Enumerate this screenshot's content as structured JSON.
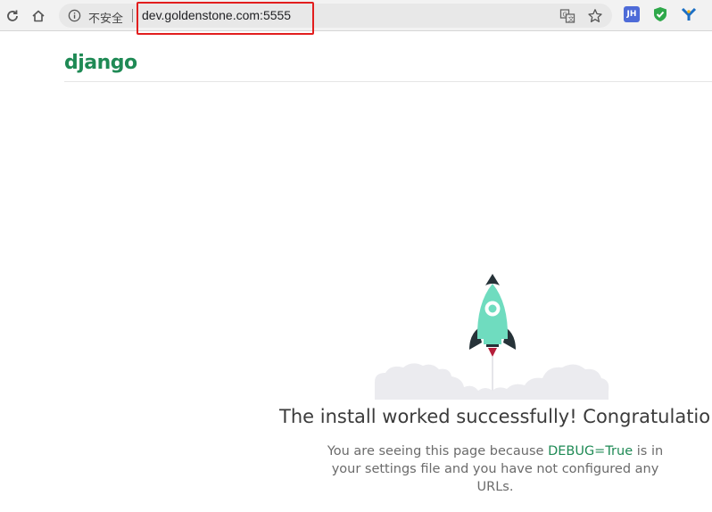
{
  "browser": {
    "security_label": "不安全",
    "url": "dev.goldenstone.com:5555",
    "icons": {
      "back": "back-icon",
      "home": "home-icon",
      "info": "info-icon",
      "translate": "translate-icon",
      "bookmark": "star-icon"
    },
    "extensions": [
      {
        "name": "jh-extension-icon",
        "text": "JH",
        "color": "#4e6bd8"
      },
      {
        "name": "shield-extension-icon",
        "color": "#2ea84a"
      },
      {
        "name": "y-extension-icon",
        "color": "#1b6fc4"
      }
    ],
    "highlight_color": "#e21e1e"
  },
  "page": {
    "logo": "django",
    "headline": "The install worked successfully! Congratulations!",
    "subtext": {
      "before": "You are seeing this page because ",
      "debug": "DEBUG=True",
      "after": " is in your settings file and you have not configured any URLs."
    },
    "colors": {
      "brand_green": "#1f8a55",
      "rocket": "#6fdcbf",
      "flame": "#b41e3a",
      "cloud": "#e8e8ec"
    }
  }
}
